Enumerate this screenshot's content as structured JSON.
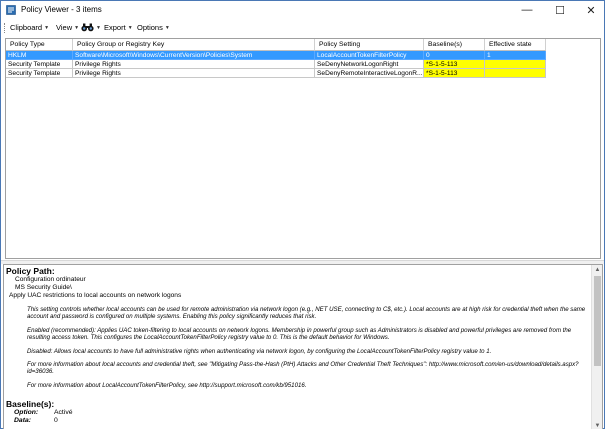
{
  "window": {
    "title": "Policy Viewer - 3 items",
    "minimize_glyph": "—",
    "maximize_glyph": "☐",
    "close_glyph": "✕"
  },
  "toolbar": {
    "clipboard": "Clipboard",
    "view": "View",
    "find_icon": "binoculars-icon",
    "export": "Export",
    "options": "Options",
    "caret": "▼"
  },
  "grid": {
    "columns": [
      "Policy Type",
      "Policy Group or Registry Key",
      "Policy Setting",
      "Baseline(s)",
      "Effective state"
    ],
    "rows": [
      {
        "type": "HKLM",
        "key": "Software\\Microsoft\\Windows\\CurrentVersion\\Policies\\System",
        "setting": "LocalAccountTokenFilterPolicy",
        "baseline": "0",
        "effective": "1",
        "selected": true
      },
      {
        "type": "Security Template",
        "key": "Privilege Rights",
        "setting": "SeDenyNetworkLogonRight",
        "baseline": "*S-1-5-113",
        "effective": "",
        "selected": false
      },
      {
        "type": "Security Template",
        "key": "Privilege Rights",
        "setting": "SeDenyRemoteInteractiveLogonR...",
        "baseline": "*S-1-5-113",
        "effective": "",
        "selected": false
      }
    ]
  },
  "details": {
    "policy_path_heading": "Policy Path:",
    "path_lines": [
      "Configuration ordinateur",
      "MS Security Guide\\",
      "Apply UAC restrictions to local accounts on network logons"
    ],
    "paragraphs": [
      "This setting controls whether local accounts can be used for remote administration via network logon (e.g., NET USE, connecting to C$, etc.). Local accounts are at high risk for credential theft when the same account and password is configured on multiple systems.  Enabling this policy significantly reduces that risk.",
      "Enabled (recommended): Applies UAC token-filtering to local accounts on network logons. Membership in powerful group such as Administrators is disabled and powerful privileges are removed from the resulting access token. This configures the LocalAccountTokenFilterPolicy registry value to 0. This is the default behavior for Windows.",
      "Disabled: Allows local accounts to have full administrative rights when authenticating via network logon, by configuring the LocalAccountTokenFilterPolicy registry value to 1.",
      "For more information about local accounts and credential theft, see \"Mitigating Pass-the-Hash (PtH) Attacks and Other Credential Theft Techniques\": http://www.microsoft.com/en-us/download/details.aspx?id=36036.",
      "For more information about LocalAccountTokenFilterPolicy, see http://support.microsoft.com/kb/951016."
    ],
    "baseline_heading": "Baseline(s):",
    "option_label": "Option:",
    "option_value": "Activé",
    "data_label": "Data:",
    "data_value": "0"
  },
  "colors": {
    "selection": "#3399ff",
    "mismatch": "#ffff00",
    "window_border": "#4a78b5"
  }
}
